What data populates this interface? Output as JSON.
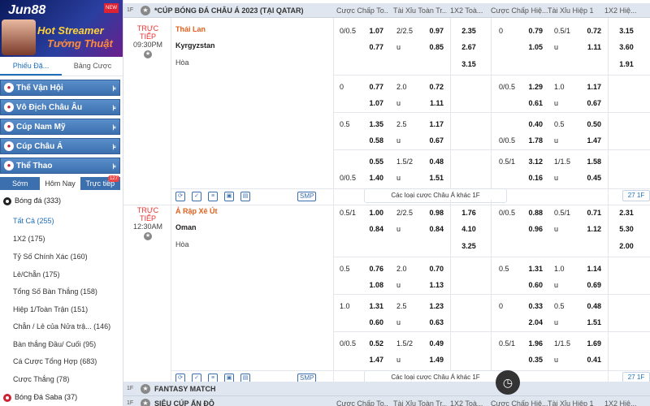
{
  "brand": {
    "logo": "Jun88",
    "flag": "NEW",
    "banner_title": "Hot Streamer",
    "banner_sub": "Tướng Thuật"
  },
  "side_tabs": [
    {
      "label": "Phiếu Đặ...",
      "active": true
    },
    {
      "label": "Bảng Cược",
      "active": false
    }
  ],
  "categories": [
    {
      "label": "Thế Vận Hội"
    },
    {
      "label": "Vô Địch Châu Âu"
    },
    {
      "label": "Cúp Nam Mỹ"
    },
    {
      "label": "Cúp Châu Á"
    },
    {
      "label": "Thể Thao"
    }
  ],
  "day_tabs": [
    {
      "label": "Sớm",
      "active": false
    },
    {
      "label": "Hôm Nay",
      "active": true
    },
    {
      "label": "Trực tiếp",
      "badge": "127",
      "active": false
    }
  ],
  "sports": [
    {
      "label": "Bóng đá",
      "count": "(333)"
    },
    {
      "label": "Bóng Đá Saba",
      "count": "(37)"
    }
  ],
  "markets": [
    {
      "label": "Tất Cả",
      "count": "(255)",
      "active": true
    },
    {
      "label": "1X2",
      "count": "(175)"
    },
    {
      "label": "Tỷ Số Chính Xác",
      "count": "(160)"
    },
    {
      "label": "Lẻ/Chẵn",
      "count": "(175)"
    },
    {
      "label": "Tổng Số Bàn Thắng",
      "count": "(158)"
    },
    {
      "label": "Hiệp 1/Toàn Trận",
      "count": "(151)"
    },
    {
      "label": "Chẵn / Lẻ của Nửa trậ...",
      "count": "(146)"
    },
    {
      "label": "Bàn thắng Đầu/ Cuối",
      "count": "(95)"
    },
    {
      "label": "Cá Cược Tổng Hợp",
      "count": "(683)"
    },
    {
      "label": "Cược Thắng",
      "count": "(78)"
    }
  ],
  "headers": [
    "Cược Chấp To...",
    "Tài Xỉu Toàn Tr...",
    "1X2 Toà...",
    "Cược Chấp Hiệ...",
    "Tài Xỉu Hiệp 1",
    "1X2 Hiệ..."
  ],
  "leagues": [
    {
      "name": "*CÚP BÓNG ĐÁ CHÂU Á 2023 (TẠI QATAR)"
    },
    {
      "name": "FANTASY MATCH"
    },
    {
      "name": "SIÊU CÚP ẤN ĐỘ"
    }
  ],
  "matches": [
    {
      "live": "TRỰC TIẾP",
      "time": "09:30PM",
      "home": "Thái Lan",
      "away": "Kyrgyzstan",
      "draw": "Hòa",
      "main": {
        "hdp_line": [
          "0/0.5",
          ""
        ],
        "hdp_odds": [
          "1.07",
          "0.77"
        ],
        "ou_line": [
          "2/2.5",
          "u"
        ],
        "ou_odds": [
          "0.97",
          "0.85"
        ],
        "x12": [
          "2.35",
          "2.67",
          "3.15"
        ],
        "h1_hdp_line": [
          "0",
          ""
        ],
        "h1_hdp_odds": [
          "0.79",
          "1.05"
        ],
        "h1_ou_line": [
          "0.5/1",
          "u"
        ],
        "h1_ou_odds": [
          "0.72",
          "1.11"
        ],
        "h1_x12": [
          "3.15",
          "3.60",
          "1.91"
        ]
      },
      "alts": [
        {
          "hl": [
            "0",
            ""
          ],
          "ho": [
            "0.77",
            "1.07"
          ],
          "ol": [
            "2.0",
            "u"
          ],
          "oo": [
            "0.72",
            "1.11"
          ],
          "h1hl": [
            "0/0.5",
            ""
          ],
          "h1ho": [
            "1.29",
            "0.61"
          ],
          "h1ol": [
            "1.0",
            "u"
          ],
          "h1oo": [
            "1.17",
            "0.67"
          ]
        },
        {
          "hl": [
            "0.5",
            ""
          ],
          "ho": [
            "1.35",
            "0.58"
          ],
          "ol": [
            "2.5",
            "u"
          ],
          "oo": [
            "1.17",
            "0.67"
          ],
          "h1hl": [
            "",
            "0/0.5"
          ],
          "h1ho": [
            "0.40",
            "1.78"
          ],
          "h1ol": [
            "0.5",
            "u"
          ],
          "h1oo": [
            "0.50",
            "1.47"
          ]
        },
        {
          "hl": [
            "",
            "0/0.5"
          ],
          "ho": [
            "0.55",
            "1.40"
          ],
          "ol": [
            "1.5/2",
            "u"
          ],
          "oo": [
            "0.48",
            "1.51"
          ],
          "h1hl": [
            "0.5/1",
            ""
          ],
          "h1ho": [
            "3.12",
            "0.16"
          ],
          "h1ol": [
            "1/1.5",
            "u"
          ],
          "h1oo": [
            "1.58",
            "0.45"
          ]
        }
      ],
      "more_label": "Các loại cược Châu Á khác",
      "count": "27"
    },
    {
      "live": "TRỰC TIẾP",
      "time": "12:30AM",
      "home": "Ả Rập Xê Út",
      "away": "Oman",
      "draw": "Hòa",
      "main": {
        "hdp_line": [
          "0.5/1",
          ""
        ],
        "hdp_odds": [
          "1.00",
          "0.84"
        ],
        "ou_line": [
          "2/2.5",
          "u"
        ],
        "ou_odds": [
          "0.98",
          "0.84"
        ],
        "x12": [
          "1.76",
          "4.10",
          "3.25"
        ],
        "h1_hdp_line": [
          "0/0.5",
          ""
        ],
        "h1_hdp_odds": [
          "0.88",
          "0.96"
        ],
        "h1_ou_line": [
          "0.5/1",
          "u"
        ],
        "h1_ou_odds": [
          "0.71",
          "1.12"
        ],
        "h1_x12": [
          "2.31",
          "5.30",
          "2.00"
        ]
      },
      "alts": [
        {
          "hl": [
            "0.5",
            ""
          ],
          "ho": [
            "0.76",
            "1.08"
          ],
          "ol": [
            "2.0",
            "u"
          ],
          "oo": [
            "0.70",
            "1.13"
          ],
          "h1hl": [
            "0.5",
            ""
          ],
          "h1ho": [
            "1.31",
            "0.60"
          ],
          "h1ol": [
            "1.0",
            "u"
          ],
          "h1oo": [
            "1.14",
            "0.69"
          ]
        },
        {
          "hl": [
            "1.0",
            ""
          ],
          "ho": [
            "1.31",
            "0.60"
          ],
          "ol": [
            "2.5",
            "u"
          ],
          "oo": [
            "1.23",
            "0.63"
          ],
          "h1hl": [
            "0",
            ""
          ],
          "h1ho": [
            "0.33",
            "2.04"
          ],
          "h1ol": [
            "0.5",
            "u"
          ],
          "h1oo": [
            "0.48",
            "1.51"
          ]
        },
        {
          "hl": [
            "0/0.5",
            ""
          ],
          "ho": [
            "0.52",
            "1.47"
          ],
          "ol": [
            "1.5/2",
            "u"
          ],
          "oo": [
            "0.49",
            "1.49"
          ],
          "h1hl": [
            "0.5/1",
            ""
          ],
          "h1ho": [
            "1.96",
            "0.35"
          ],
          "h1ol": [
            "1/1.5",
            "u"
          ],
          "h1oo": [
            "1.69",
            "0.41"
          ]
        }
      ],
      "more_label": "Các loại cược Châu Á khác",
      "count": "27"
    }
  ],
  "footer_icons": [
    "refresh-icon",
    "check-icon",
    "bars-icon",
    "monitor-icon",
    "board-icon",
    "SMP"
  ]
}
